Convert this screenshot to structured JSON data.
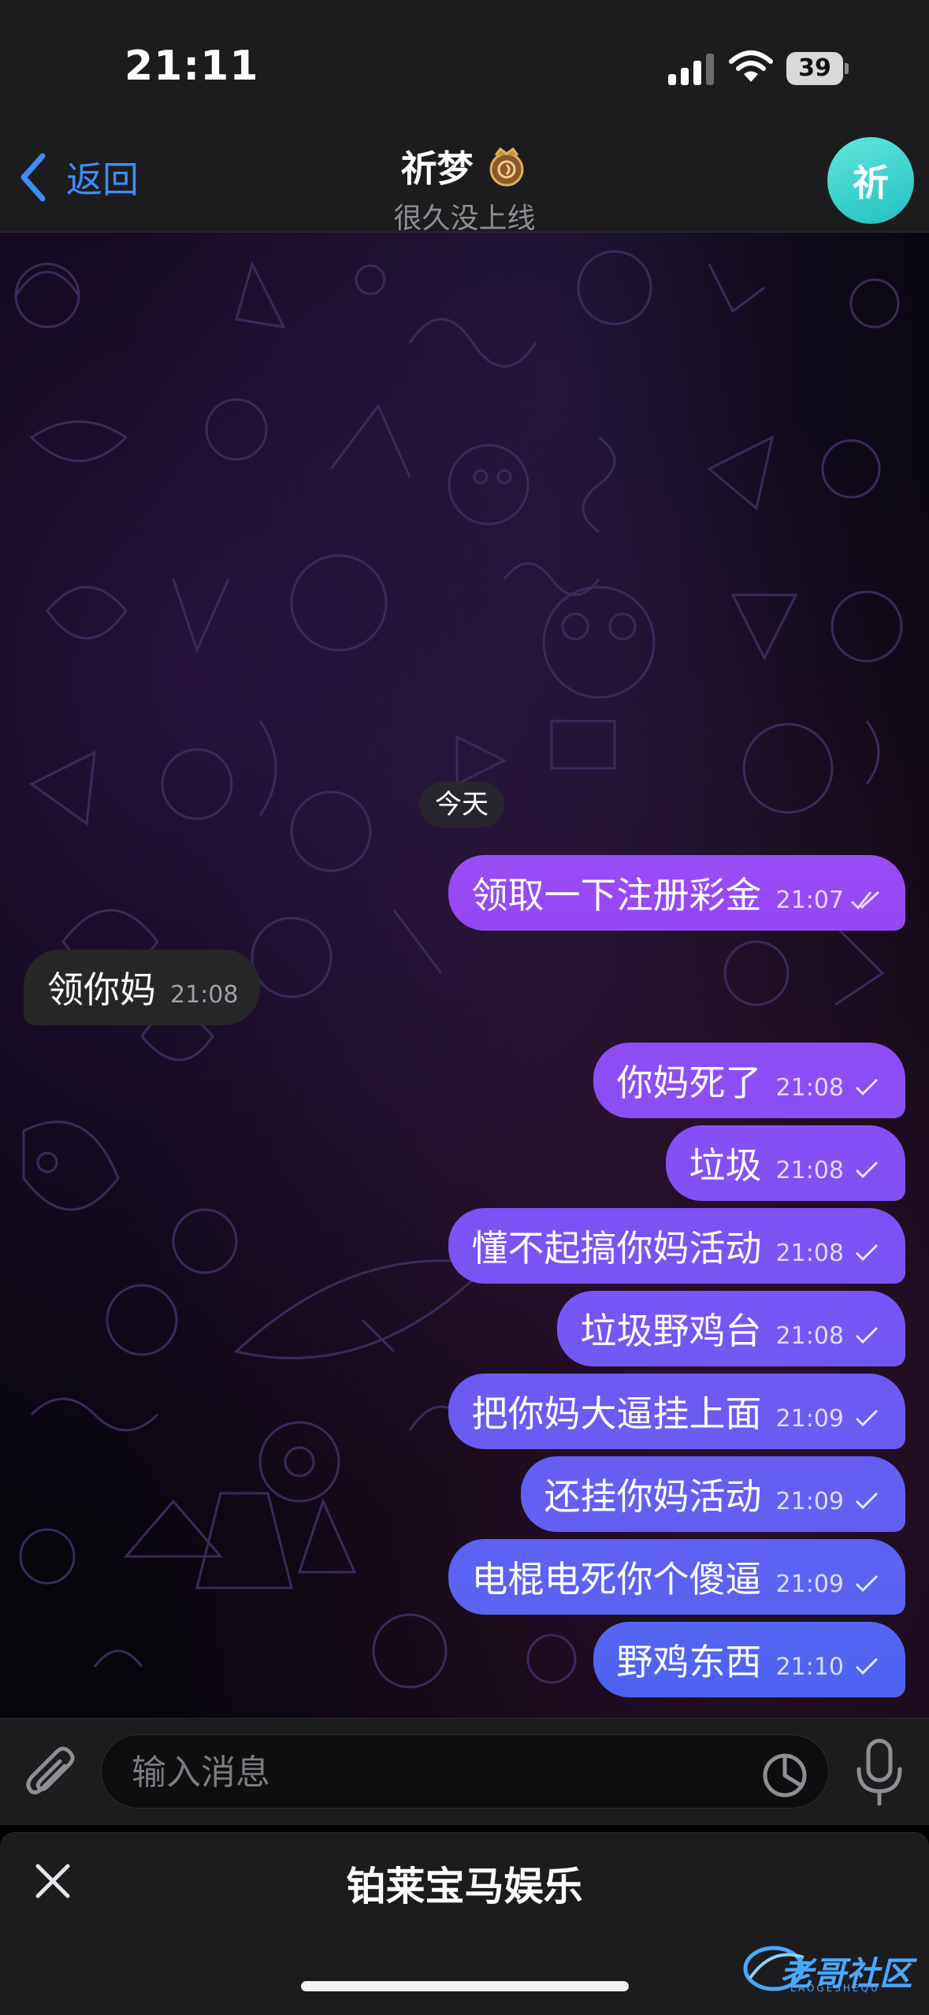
{
  "status_bar": {
    "time": "21:11",
    "battery": "39"
  },
  "header": {
    "back_label": "返回",
    "contact_name": "祈梦",
    "contact_status": "很久没上线",
    "avatar_initial": "祈",
    "avatar_color": "#34d0cc"
  },
  "chat": {
    "date_divider": "今天",
    "messages": [
      {
        "direction": "out",
        "text": "领取一下注册彩金",
        "time": "21:07",
        "status": "read"
      },
      {
        "direction": "in",
        "text": "领你妈",
        "time": "21:08"
      },
      {
        "direction": "out",
        "text": "你妈死了",
        "time": "21:08",
        "status": "sent"
      },
      {
        "direction": "out",
        "text": "垃圾",
        "time": "21:08",
        "status": "sent"
      },
      {
        "direction": "out",
        "text": "懂不起搞你妈活动",
        "time": "21:08",
        "status": "sent"
      },
      {
        "direction": "out",
        "text": "垃圾野鸡台",
        "time": "21:08",
        "status": "sent"
      },
      {
        "direction": "out",
        "text": "把你妈大逼挂上面",
        "time": "21:09",
        "status": "sent"
      },
      {
        "direction": "out",
        "text": "还挂你妈活动",
        "time": "21:09",
        "status": "sent"
      },
      {
        "direction": "out",
        "text": "电棍电死你个傻逼",
        "time": "21:09",
        "status": "sent"
      },
      {
        "direction": "out",
        "text": "野鸡东西",
        "time": "21:10",
        "status": "sent"
      }
    ]
  },
  "composer": {
    "placeholder": "输入消息"
  },
  "bottom_panel": {
    "title": "铂莱宝马娱乐"
  },
  "watermark": {
    "text": "老哥社区",
    "subtext": "LAOGESHEQU"
  },
  "colors": {
    "accent_blue": "#3e8df7",
    "outgoing_bubble_top": "#9b4cf5",
    "outgoing_bubble_bottom": "#4a63f2",
    "incoming_bubble": "#262628"
  }
}
